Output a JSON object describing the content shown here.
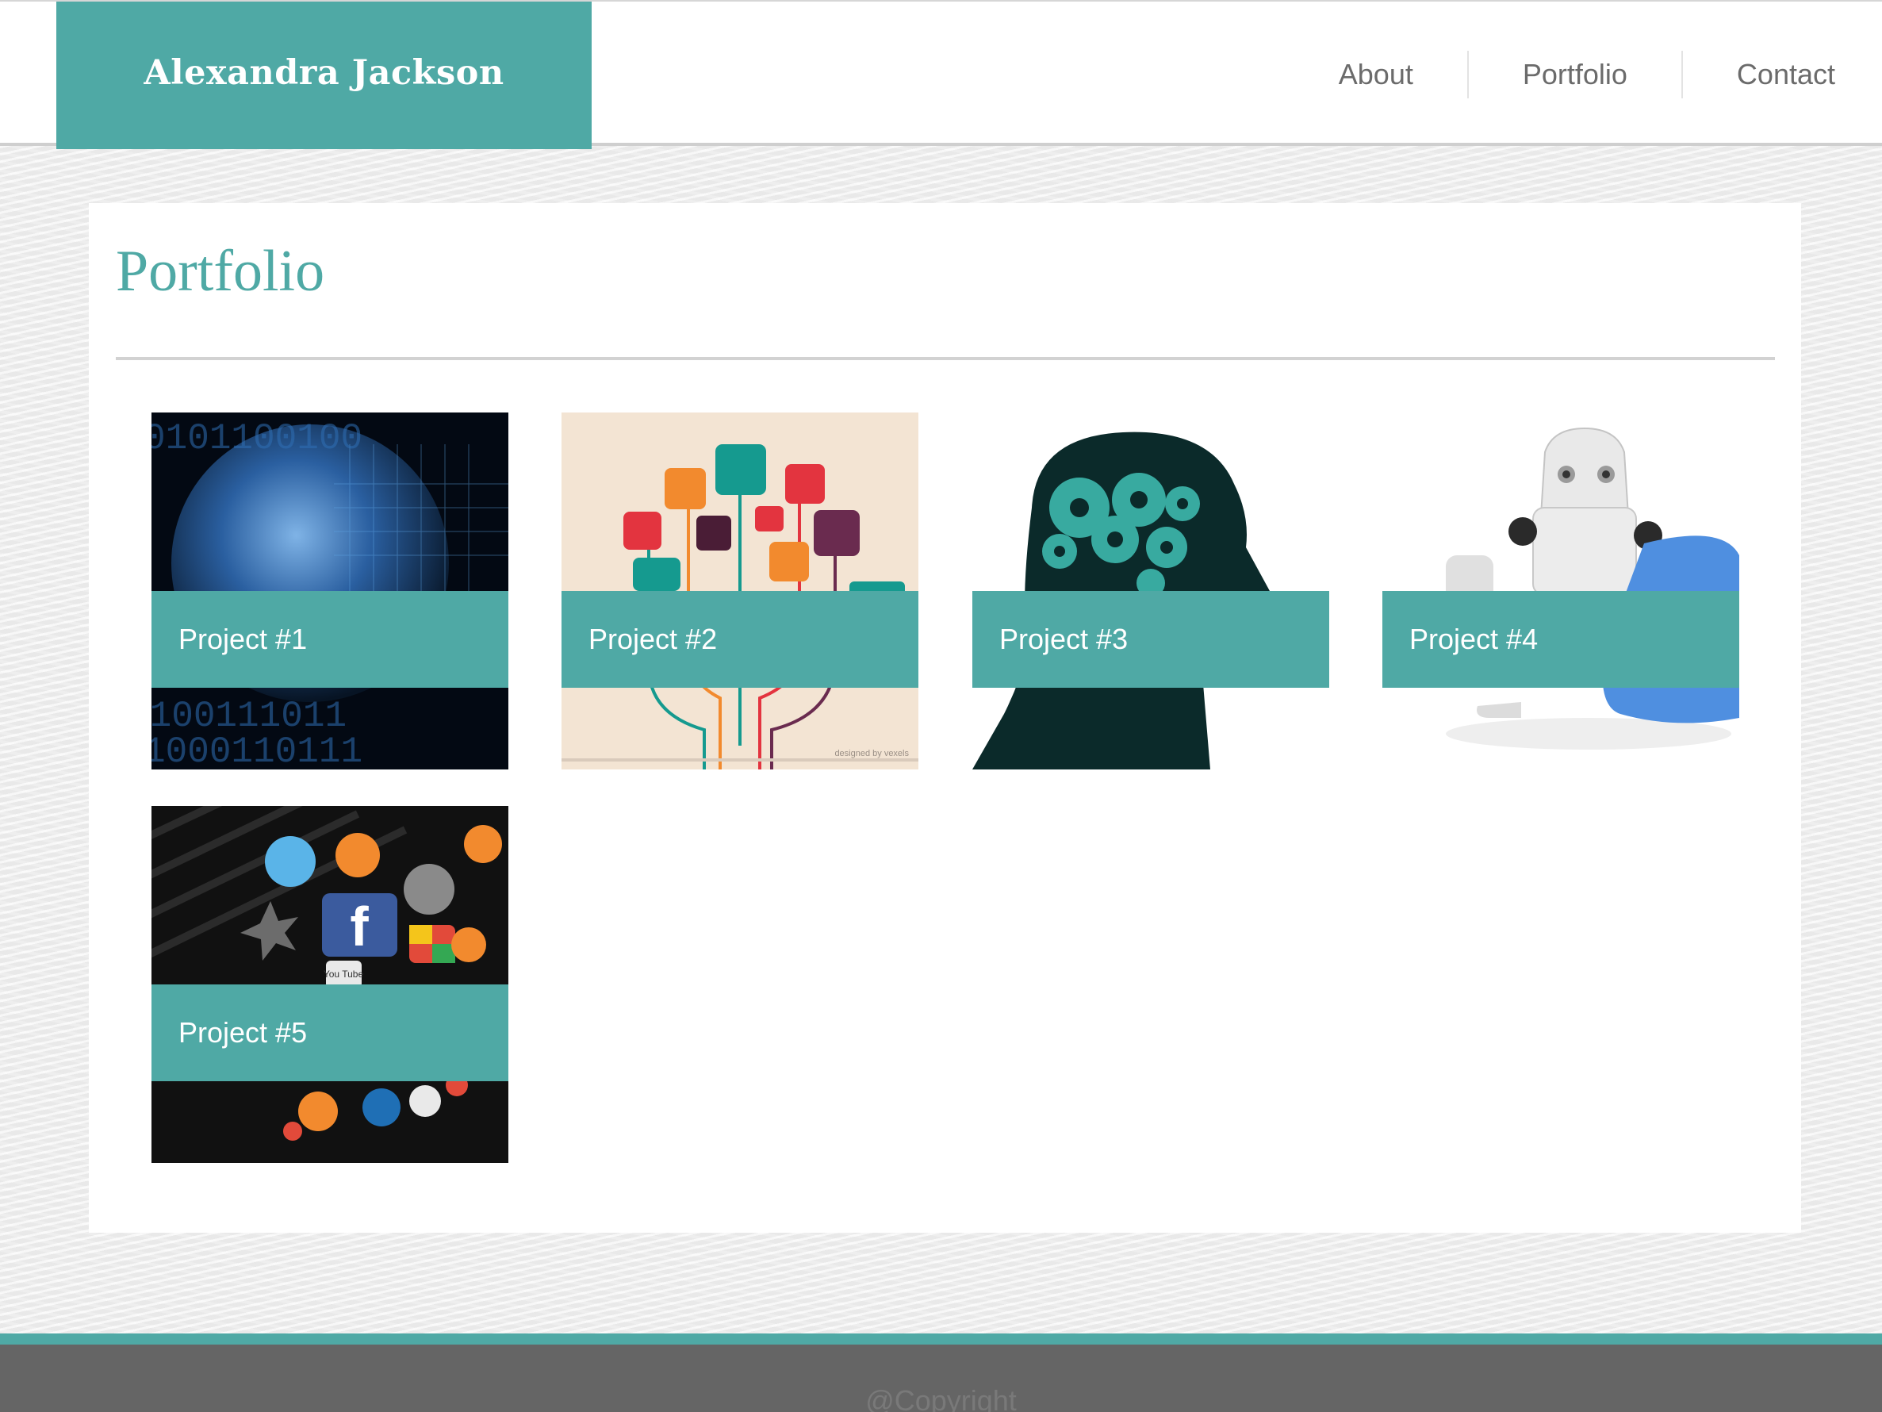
{
  "header": {
    "brand": "Alexandra Jackson",
    "nav": [
      "About",
      "Portfolio",
      "Contact"
    ]
  },
  "main": {
    "title": "Portfolio",
    "projects": [
      {
        "label": "Project #1",
        "image": "globe-binary-image"
      },
      {
        "label": "Project #2",
        "image": "app-icon-tree-image",
        "credit": "designed by vexels"
      },
      {
        "label": "Project #3",
        "image": "gear-head-image"
      },
      {
        "label": "Project #4",
        "image": "robot-image"
      },
      {
        "label": "Project #5",
        "image": "social-icons-image",
        "icon_text": [
          "f",
          "You Tube"
        ]
      }
    ]
  },
  "footer": {
    "text": "@Copyright"
  },
  "colors": {
    "accent": "#4fa9a5",
    "footer": "#656565",
    "nav_text": "#6b6b6b"
  }
}
